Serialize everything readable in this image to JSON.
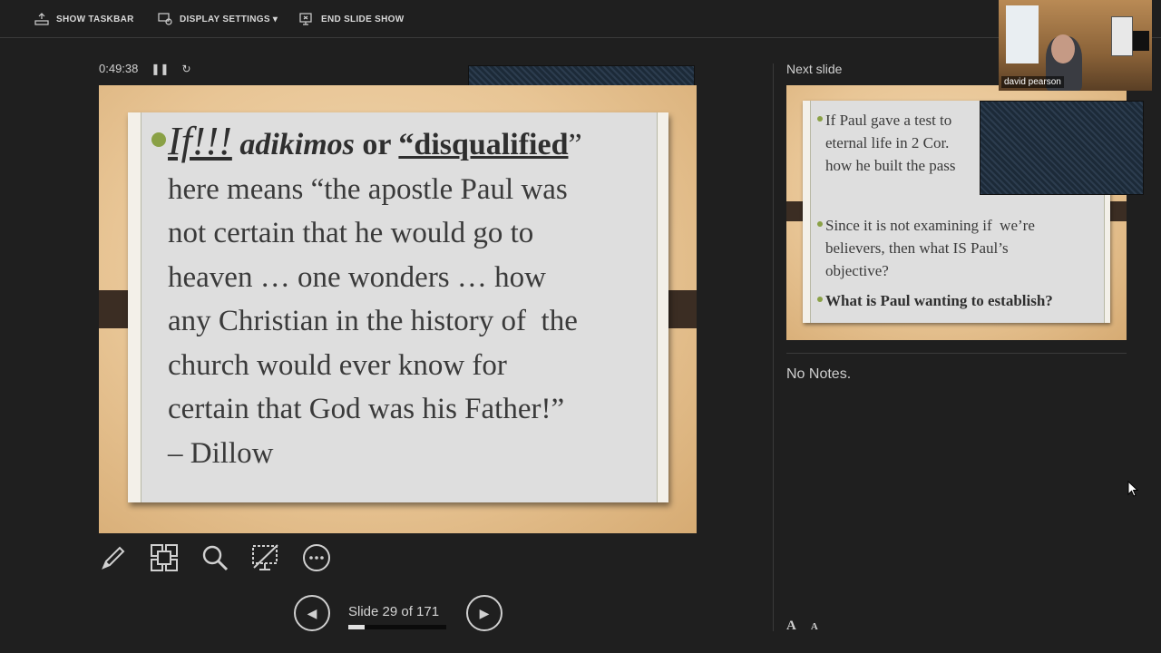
{
  "toolbar": {
    "show_taskbar": "SHOW TASKBAR",
    "display_settings": "DISPLAY SETTINGS ▾",
    "end_slide_show": "END SLIDE SHOW"
  },
  "timer": {
    "elapsed": "0:49:38",
    "pause_icon": "pause-icon",
    "reset_icon": "reset-icon"
  },
  "current_slide": {
    "line1_if": "If!!!",
    "line1_word": "adikimos",
    "line1_or": "or",
    "line1_quote": "“disqualified",
    "line1_end": "”",
    "line2": "here means “the apostle Paul was",
    "line3": "not certain that he would go to",
    "line4": "heaven … one wonders … how",
    "line5": "any Christian in the history of  the",
    "line6": "church would ever know for",
    "line7": "certain that God was his Father!”",
    "line8": "– Dillow"
  },
  "tools": [
    "pen-icon",
    "slides-grid-icon",
    "zoom-icon",
    "black-screen-icon",
    "more-options-icon"
  ],
  "navigation": {
    "counter": "Slide 29 of 171",
    "progress": 0.17
  },
  "next_slide": {
    "label": "Next slide",
    "b1_l1": "If Paul gave a test to",
    "b1_l2": "eternal life in 2 Cor.",
    "b1_l3": "how he built the pass",
    "b2_l1": "Since it is not examining if  we’re",
    "b2_l2": "believers, then what IS Paul’s",
    "b2_l3": "objective?",
    "b3": "What is Paul wanting to establish?"
  },
  "notes": "No Notes.",
  "font_controls": {
    "increase": "A",
    "decrease": "A"
  },
  "webcam": {
    "participant_name": "david pearson"
  }
}
